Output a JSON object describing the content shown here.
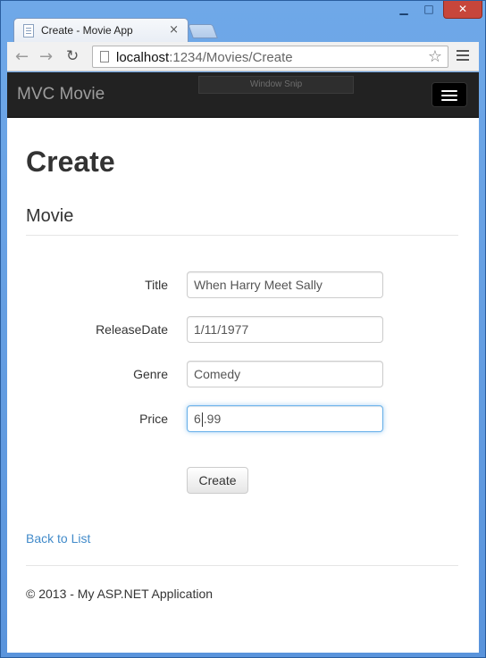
{
  "browser": {
    "tab_title": "Create - Movie App",
    "tab_close": "×",
    "url_host": "localhost",
    "url_path": ":1234/Movies/Create",
    "window_controls": {
      "minimize": "▁",
      "maximize": "□",
      "close": "✕"
    },
    "nav": {
      "back": "←",
      "forward": "→",
      "reload": "↻",
      "star": "☆"
    }
  },
  "navbar": {
    "brand": "MVC Movie",
    "overlay_label": "Window Snip"
  },
  "page": {
    "title": "Create",
    "section_title": "Movie",
    "back_link": "Back to List",
    "footer": "© 2013 - My ASP.NET Application"
  },
  "form": {
    "fields": [
      {
        "label": "Title",
        "value": "When Harry Meet Sally"
      },
      {
        "label": "ReleaseDate",
        "value": "1/11/1977"
      },
      {
        "label": "Genre",
        "value": "Comedy"
      },
      {
        "label": "Price",
        "value_before_caret": "6",
        "value_after_caret": ".99"
      }
    ],
    "submit_label": "Create"
  }
}
